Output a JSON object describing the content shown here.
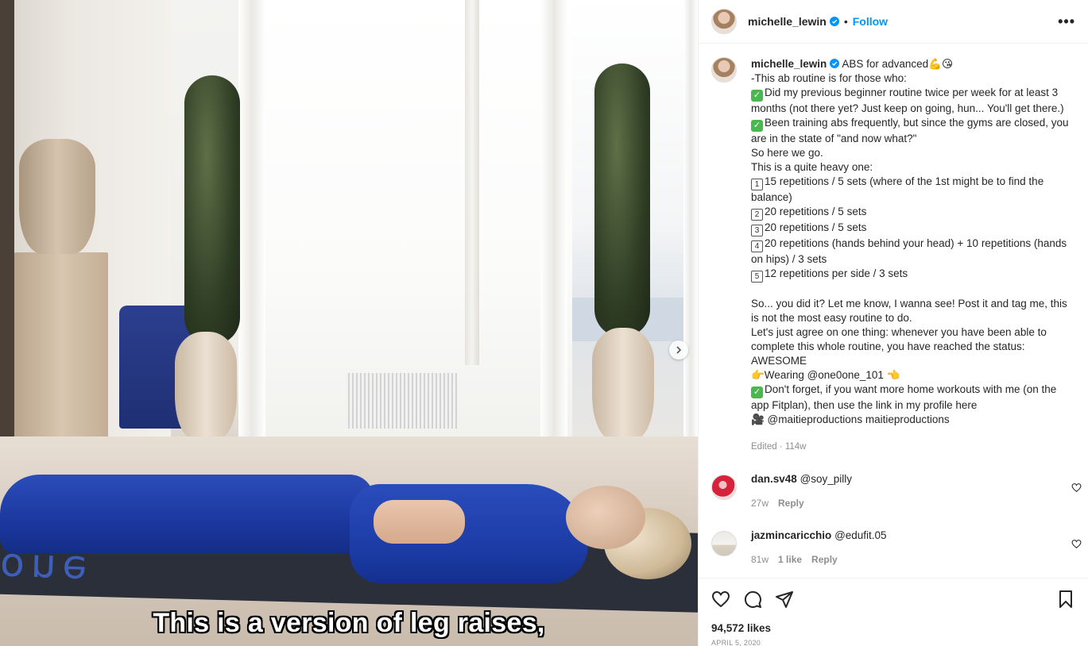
{
  "media": {
    "subtitle": "This is a version of leg raises,",
    "mat_logo": "one"
  },
  "header": {
    "username": "michelle_lewin",
    "separator": "•",
    "follow_label": "Follow",
    "more_label": "•••"
  },
  "caption": {
    "username": "michelle_lewin",
    "first_line": "ABS for advanced💪😘",
    "lines": [
      {
        "prefix": "",
        "text": "-This ab routine is for those who:"
      },
      {
        "prefix": "check",
        "text": "Did my previous beginner routine twice per week for at least 3 months (not there yet? Just keep on going, hun... You'll get there.)"
      },
      {
        "prefix": "check",
        "text": "Been training abs frequently, but since the gyms are closed, you are in the state of \"and now what?\""
      },
      {
        "prefix": "",
        "text": "So here we go."
      },
      {
        "prefix": "",
        "text": "This is a quite heavy one:"
      },
      {
        "prefix": "1",
        "text": "15 repetitions / 5 sets (where of the 1st might be to find the balance)"
      },
      {
        "prefix": "2",
        "text": "20 repetitions / 5 sets"
      },
      {
        "prefix": "3",
        "text": "20 repetitions / 5 sets"
      },
      {
        "prefix": "4",
        "text": "20 repetitions (hands behind your head) + 10 repetitions (hands on hips) / 3 sets"
      },
      {
        "prefix": "5",
        "text": "12 repetitions per side / 3 sets"
      },
      {
        "prefix": "",
        "text": " "
      },
      {
        "prefix": "",
        "text": "So... you did it? Let me know, I wanna see! Post it and tag me, this is not the most easy routine to do."
      },
      {
        "prefix": "",
        "text": "Let's just agree on one thing: whenever you have been able to complete this whole routine, you have reached the status: AWESOME"
      },
      {
        "prefix": "",
        "text": "👉Wearing @one0one_101 👈"
      },
      {
        "prefix": "check",
        "text": "Don't forget, if you want more home workouts with me (on the app Fitplan), then use the link in my profile here"
      },
      {
        "prefix": "",
        "text": "🎥 @maitieproductions maitieproductions"
      }
    ],
    "meta": "Edited · 114w"
  },
  "comments": [
    {
      "username": "dan.sv48",
      "text": "@soy_pilly",
      "age": "27w",
      "likes": "",
      "reply": "Reply"
    },
    {
      "username": "jazmincaricchio",
      "text": "@edufit.05",
      "age": "81w",
      "likes": "1 like",
      "reply": "Reply"
    }
  ],
  "footer": {
    "likes": "94,572 likes",
    "date": "APRIL 5, 2020"
  },
  "colors": {
    "accent": "#0095f6",
    "verified": "#0095f6",
    "muted": "#8e8e8e"
  }
}
